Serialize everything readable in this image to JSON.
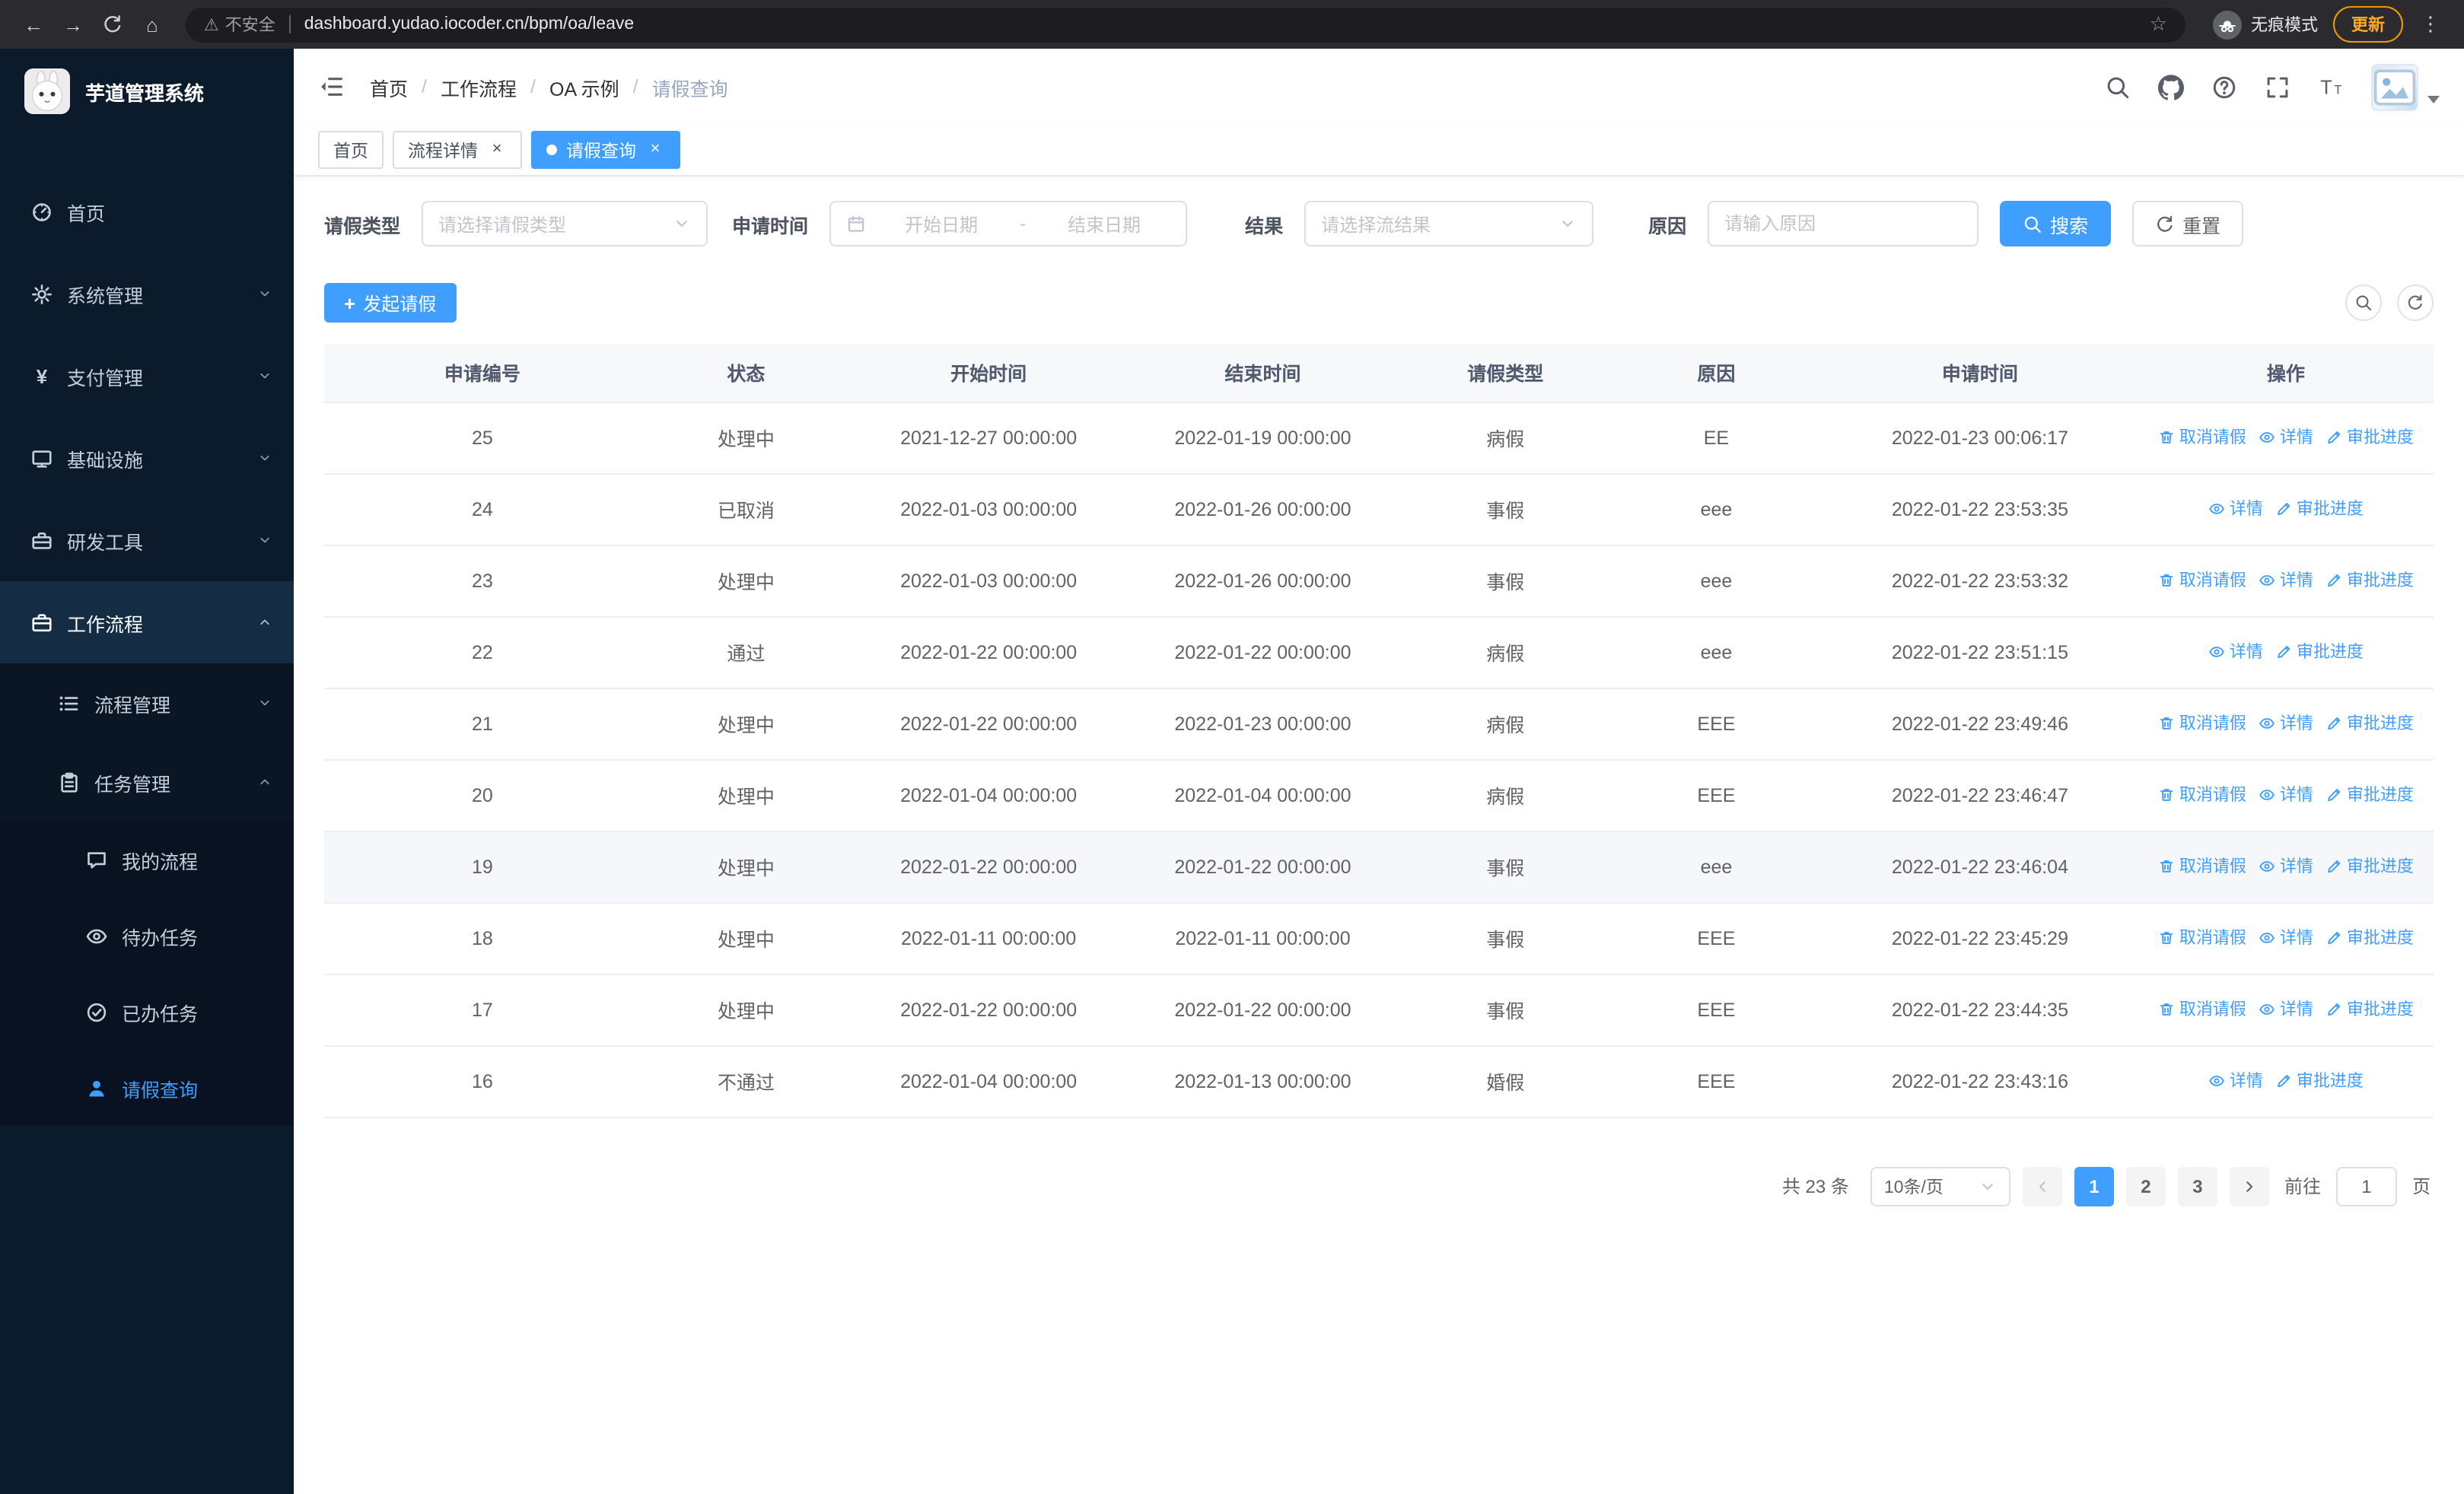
{
  "colors": {
    "accent": "#409eff",
    "link": "#409eff",
    "sidebar_bg": "#0c1b2b",
    "sidebar_sub_bg": "#0a1624",
    "sidebar_deep_bg": "#081220",
    "sidebar_highlight_bg": "#142c44",
    "browser_bar_bg": "#2b2b2f",
    "update_pill": "#f29900",
    "row_hover": "#f5f7fa",
    "table_border": "#ebeef5"
  },
  "browser": {
    "security_warning": "不安全",
    "url": "dashboard.yudao.iocoder.cn/bpm/oa/leave",
    "incognito_label": "无痕模式",
    "update_label": "更新"
  },
  "sidebar": {
    "logo_title": "芋道管理系统",
    "menu": [
      {
        "key": "home",
        "label": "首页",
        "icon": "dashboard",
        "level": 1
      },
      {
        "key": "system",
        "label": "系统管理",
        "icon": "gear",
        "level": 1,
        "arrow": "down"
      },
      {
        "key": "payment",
        "label": "支付管理",
        "icon": "yen",
        "level": 1,
        "arrow": "down"
      },
      {
        "key": "infrastructure",
        "label": "基础设施",
        "icon": "monitor",
        "level": 1,
        "arrow": "down"
      },
      {
        "key": "devtools",
        "label": "研发工具",
        "icon": "toolbox",
        "level": 1,
        "arrow": "down"
      },
      {
        "key": "workflow",
        "label": "工作流程",
        "icon": "briefcase",
        "level": 1,
        "arrow": "up",
        "expanded": true
      },
      {
        "key": "process-mgmt",
        "label": "流程管理",
        "icon": "list",
        "level": 2,
        "arrow": "down"
      },
      {
        "key": "task-mgmt",
        "label": "任务管理",
        "icon": "clipboard",
        "level": 2,
        "arrow": "up",
        "expanded": true
      },
      {
        "key": "my-process",
        "label": "我的流程",
        "icon": "chat",
        "level": 3
      },
      {
        "key": "todo-tasks",
        "label": "待办任务",
        "icon": "eye",
        "level": 3
      },
      {
        "key": "done-tasks",
        "label": "已办任务",
        "icon": "check-circle",
        "level": 3
      },
      {
        "key": "leave-query",
        "label": "请假查询",
        "icon": "user",
        "level": 3,
        "active": true
      }
    ]
  },
  "navbar": {
    "breadcrumb": [
      "首页",
      "工作流程",
      "OA 示例",
      "请假查询"
    ]
  },
  "tabs": [
    {
      "key": "home",
      "label": "首页",
      "closable": false,
      "active": false
    },
    {
      "key": "process-detail",
      "label": "流程详情",
      "closable": true,
      "active": false
    },
    {
      "key": "leave-query",
      "label": "请假查询",
      "closable": true,
      "active": true
    }
  ],
  "filters": {
    "leave_type_label": "请假类型",
    "leave_type_placeholder": "请选择请假类型",
    "apply_time_label": "申请时间",
    "start_date_placeholder": "开始日期",
    "range_separator": "-",
    "end_date_placeholder": "结束日期",
    "result_label": "结果",
    "result_placeholder": "请选择流结果",
    "reason_label": "原因",
    "reason_placeholder": "请输入原因",
    "search_button": "搜索",
    "reset_button": "重置"
  },
  "toolbar": {
    "create_button": "发起请假"
  },
  "table": {
    "columns": [
      "申请编号",
      "状态",
      "开始时间",
      "结束时间",
      "请假类型",
      "原因",
      "申请时间",
      "操作"
    ],
    "column_keys": [
      "id",
      "status",
      "start-time",
      "end-time",
      "leave-type",
      "reason",
      "apply-time",
      "actions"
    ],
    "action_labels": {
      "cancel": "取消请假",
      "detail": "详情",
      "progress": "审批进度"
    },
    "rows": [
      {
        "id": "25",
        "status": "处理中",
        "start": "2021-12-27 00:00:00",
        "end": "2022-01-19 00:00:00",
        "type": "病假",
        "reason": "EE",
        "apply_time": "2022-01-23 00:06:17",
        "cancellable": true,
        "hover": false
      },
      {
        "id": "24",
        "status": "已取消",
        "start": "2022-01-03 00:00:00",
        "end": "2022-01-26 00:00:00",
        "type": "事假",
        "reason": "eee",
        "apply_time": "2022-01-22 23:53:35",
        "cancellable": false,
        "hover": false
      },
      {
        "id": "23",
        "status": "处理中",
        "start": "2022-01-03 00:00:00",
        "end": "2022-01-26 00:00:00",
        "type": "事假",
        "reason": "eee",
        "apply_time": "2022-01-22 23:53:32",
        "cancellable": true,
        "hover": false
      },
      {
        "id": "22",
        "status": "通过",
        "start": "2022-01-22 00:00:00",
        "end": "2022-01-22 00:00:00",
        "type": "病假",
        "reason": "eee",
        "apply_time": "2022-01-22 23:51:15",
        "cancellable": false,
        "hover": false
      },
      {
        "id": "21",
        "status": "处理中",
        "start": "2022-01-22 00:00:00",
        "end": "2022-01-23 00:00:00",
        "type": "病假",
        "reason": "EEE",
        "apply_time": "2022-01-22 23:49:46",
        "cancellable": true,
        "hover": false
      },
      {
        "id": "20",
        "status": "处理中",
        "start": "2022-01-04 00:00:00",
        "end": "2022-01-04 00:00:00",
        "type": "病假",
        "reason": "EEE",
        "apply_time": "2022-01-22 23:46:47",
        "cancellable": true,
        "hover": false
      },
      {
        "id": "19",
        "status": "处理中",
        "start": "2022-01-22 00:00:00",
        "end": "2022-01-22 00:00:00",
        "type": "事假",
        "reason": "eee",
        "apply_time": "2022-01-22 23:46:04",
        "cancellable": true,
        "hover": true
      },
      {
        "id": "18",
        "status": "处理中",
        "start": "2022-01-11 00:00:00",
        "end": "2022-01-11 00:00:00",
        "type": "事假",
        "reason": "EEE",
        "apply_time": "2022-01-22 23:45:29",
        "cancellable": true,
        "hover": false
      },
      {
        "id": "17",
        "status": "处理中",
        "start": "2022-01-22 00:00:00",
        "end": "2022-01-22 00:00:00",
        "type": "事假",
        "reason": "EEE",
        "apply_time": "2022-01-22 23:44:35",
        "cancellable": true,
        "hover": false
      },
      {
        "id": "16",
        "status": "不通过",
        "start": "2022-01-04 00:00:00",
        "end": "2022-01-13 00:00:00",
        "type": "婚假",
        "reason": "EEE",
        "apply_time": "2022-01-22 23:43:16",
        "cancellable": false,
        "hover": false
      }
    ]
  },
  "pagination": {
    "total_text": "共 23 条",
    "page_size_text": "10条/页",
    "pages": [
      "1",
      "2",
      "3"
    ],
    "active_page": "1",
    "goto_label": "前往",
    "goto_value": "1",
    "goto_unit": "页"
  },
  "icons_unicode": {
    "back": "←",
    "forward": "→",
    "home": "⌂",
    "star": "☆",
    "warning": "⚠",
    "menu-dots": "⋮",
    "close": "×",
    "plus": "+"
  }
}
